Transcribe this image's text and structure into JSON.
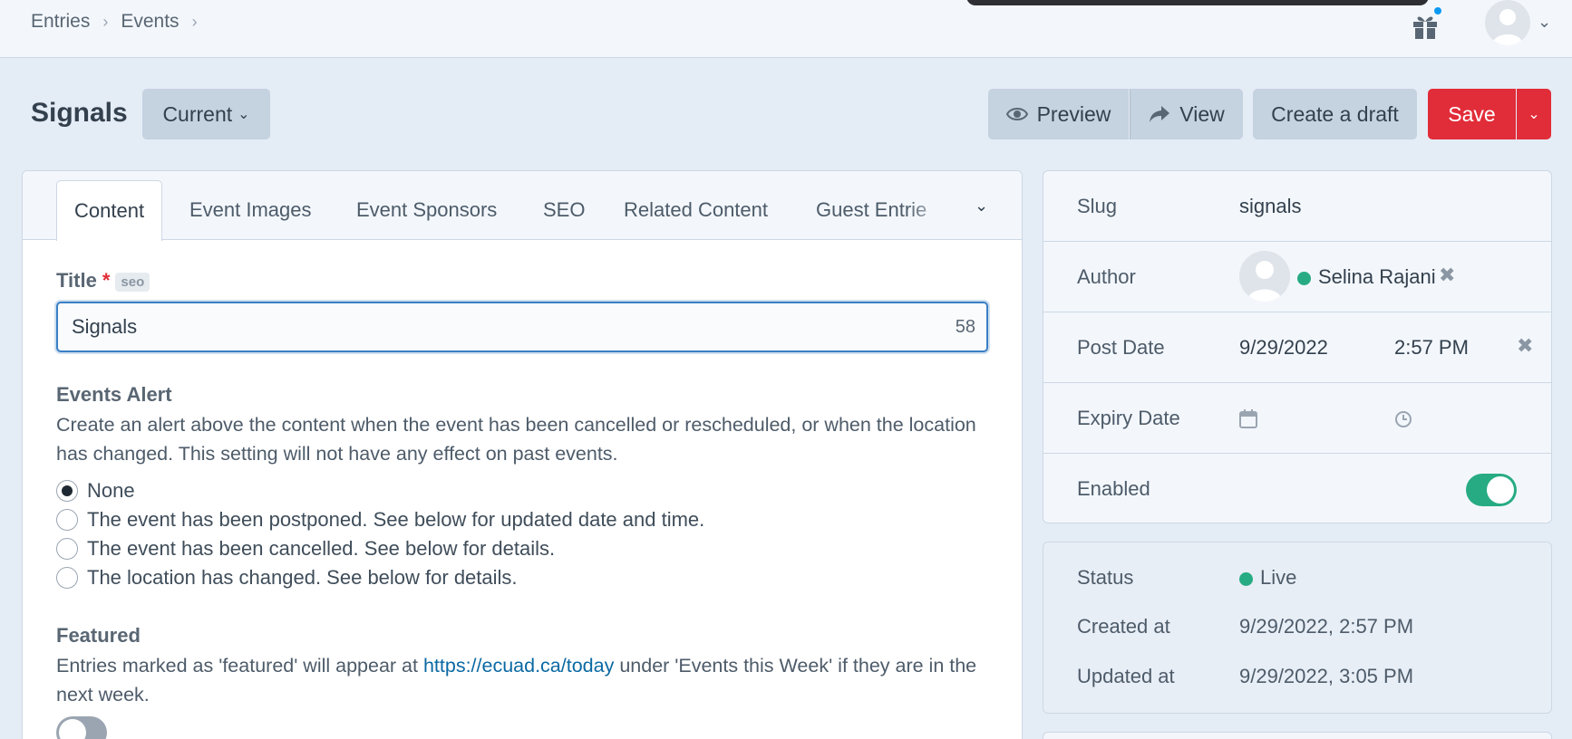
{
  "breadcrumbs": [
    "Entries",
    "Events"
  ],
  "icons": {
    "gift": "gift-icon",
    "avatar": "user-avatar-icon"
  },
  "header": {
    "title": "Signals",
    "revision_label": "Current",
    "preview_label": "Preview",
    "view_label": "View",
    "draft_label": "Create a draft",
    "save_label": "Save"
  },
  "tabs": [
    "Content",
    "Event Images",
    "Event Sponsors",
    "SEO",
    "Related Content",
    "Guest Entrie"
  ],
  "content": {
    "title_label": "Title",
    "title_required": "*",
    "seo_badge": "seo",
    "title_value": "Signals",
    "title_count": "58",
    "alert_label": "Events Alert",
    "alert_desc": "Create an alert above the content when the event has been cancelled or rescheduled, or when the location has changed. This setting will not have any effect on past events.",
    "alert_options": [
      {
        "label": "None",
        "selected": true
      },
      {
        "label": "The event has been postponed. See below for updated date and time.",
        "selected": false
      },
      {
        "label": "The event has been cancelled. See below for details.",
        "selected": false
      },
      {
        "label": "The location has changed. See below for details.",
        "selected": false
      }
    ],
    "featured_label": "Featured",
    "featured_desc_before": "Entries marked as 'featured' will appear at ",
    "featured_link": "https://ecuad.ca/today",
    "featured_desc_after": " under 'Events this Week' if they are in the next week.",
    "featured_on": false
  },
  "meta": {
    "slug_label": "Slug",
    "slug_value": "signals",
    "author_label": "Author",
    "author_name": "Selina Rajani",
    "post_date_label": "Post Date",
    "post_date": "9/29/2022",
    "post_time": "2:57 PM",
    "expiry_label": "Expiry Date",
    "enabled_label": "Enabled",
    "enabled": true
  },
  "status": {
    "status_label": "Status",
    "status_value": "Live",
    "created_label": "Created at",
    "created_value": "9/29/2022, 2:57 PM",
    "updated_label": "Updated at",
    "updated_value": "9/29/2022, 3:05 PM"
  },
  "colors": {
    "accent": "#3a7fc5",
    "save": "#e12d39",
    "live": "#27ab83",
    "link": "#0b69a3"
  }
}
